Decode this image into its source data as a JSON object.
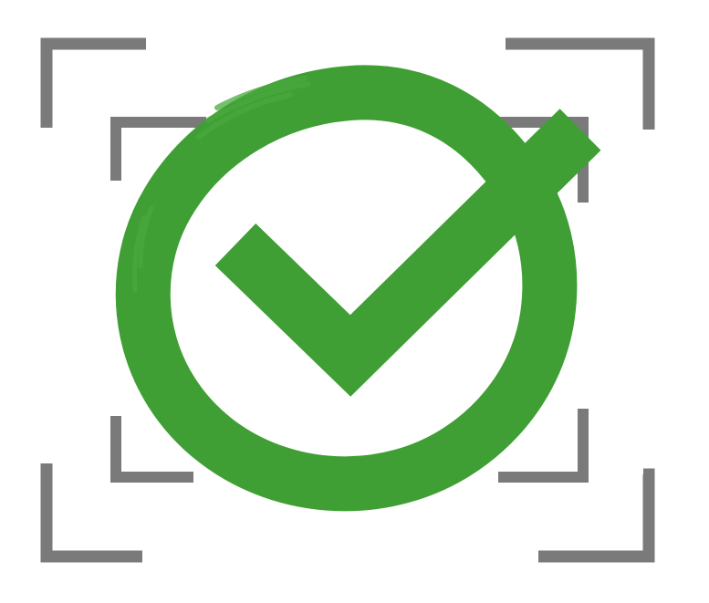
{
  "image": {
    "icon": "check-circle-icon",
    "frame_icon": "scan-frame-brackets",
    "colors": {
      "background": "#ffffff",
      "check_green": "#3f9f34",
      "bracket_gray": "#7a7a7a"
    }
  }
}
